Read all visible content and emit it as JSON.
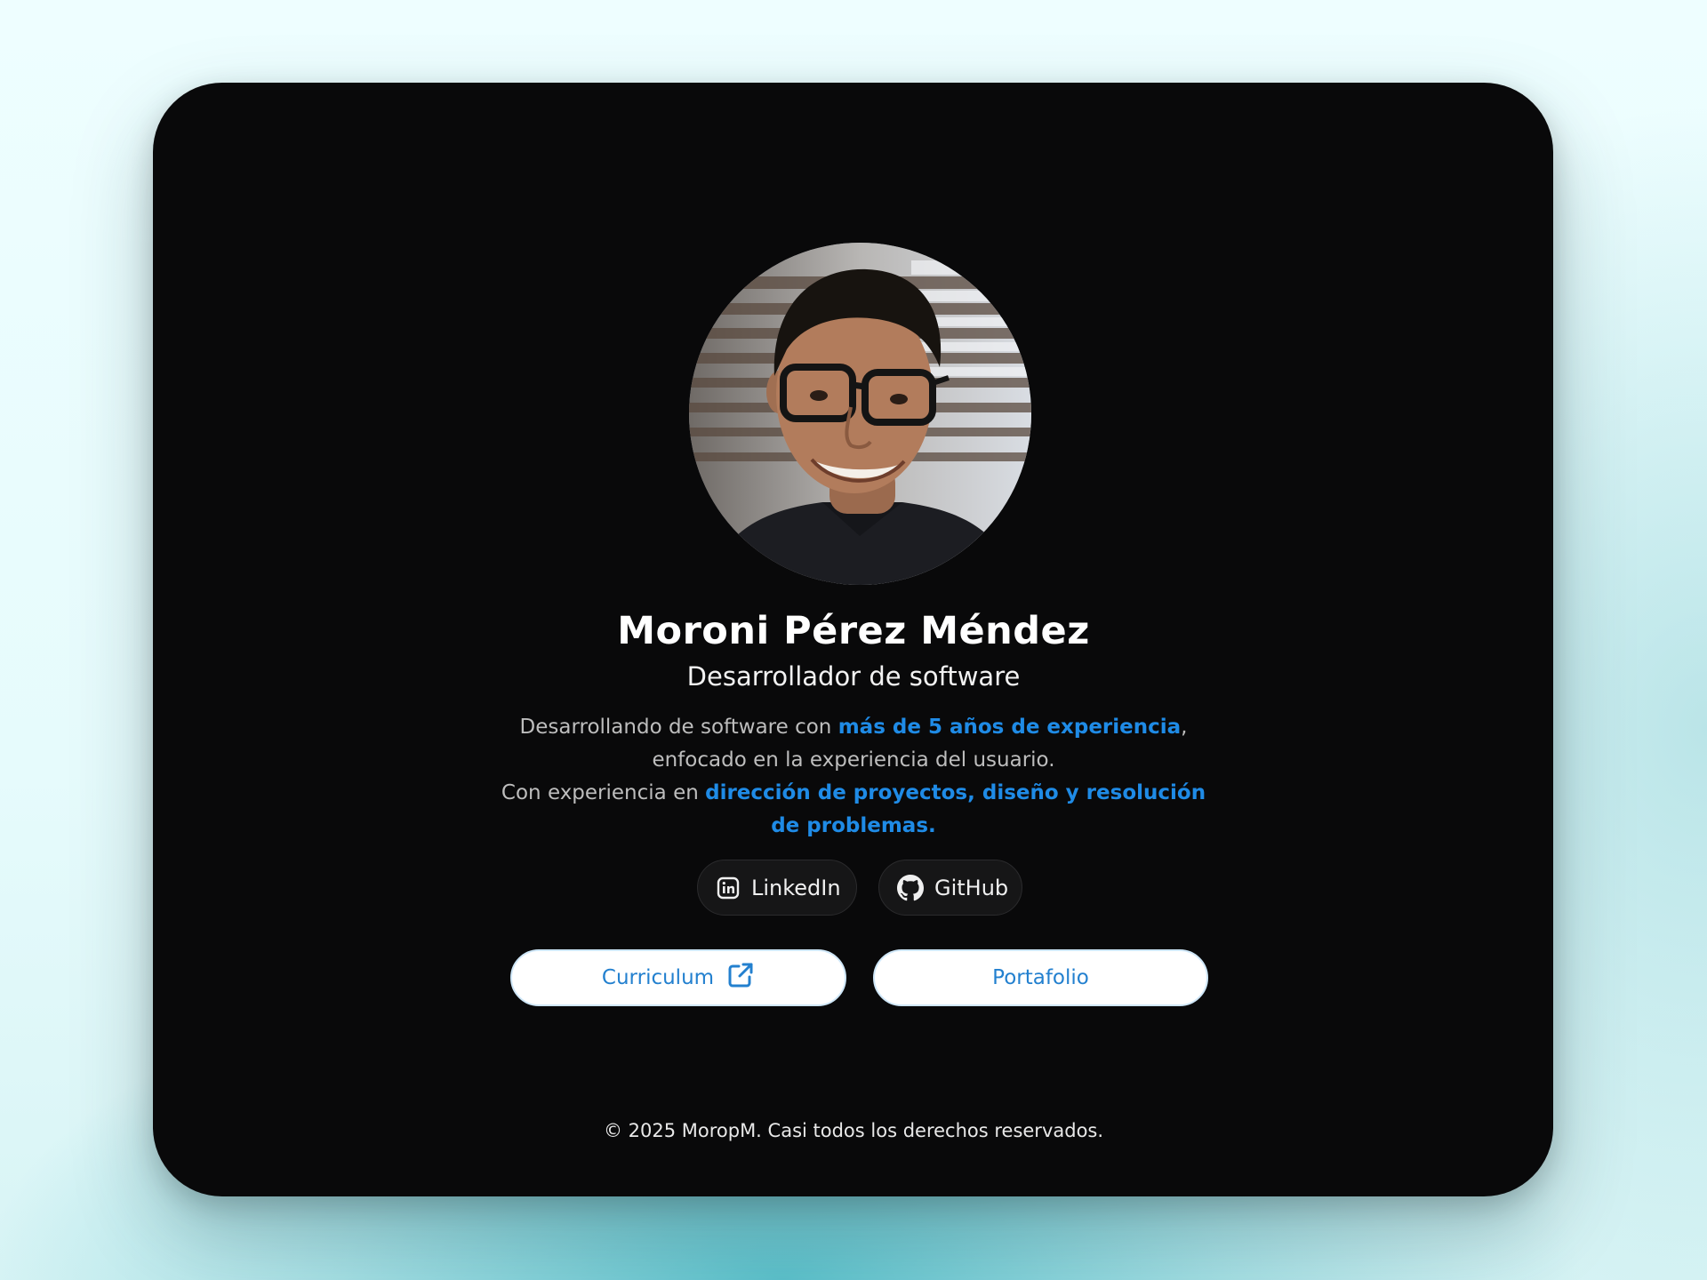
{
  "profile": {
    "name": "Moroni Pérez Méndez",
    "role": "Desarrollador de software",
    "avatar_alt": "profile photo"
  },
  "bio": {
    "line1_pre": "Desarrollando de software con ",
    "line1_highlight": "más de 5 años de experiencia",
    "line1_post": ",",
    "line2": "enfocado en la experiencia del usuario.",
    "line3_pre": "Con experiencia en ",
    "line3_highlight": "dirección de proyectos, diseño y resolución de problemas."
  },
  "socials": {
    "linkedin": {
      "label": "LinkedIn",
      "icon": "linkedin-icon"
    },
    "github": {
      "label": "GitHub",
      "icon": "github-icon"
    }
  },
  "actions": {
    "curriculum": {
      "label": "Curriculum",
      "icon": "external-link-icon"
    },
    "portfolio": {
      "label": "Portafolio"
    }
  },
  "footer": {
    "text": "© 2025 MoropM. Casi todos los derechos reservados."
  },
  "colors": {
    "card_background": "#09090a",
    "highlight": "#1f8be6",
    "button_text": "#2380cf",
    "page_background": "#eafeff",
    "glow": "#46b8c4"
  }
}
